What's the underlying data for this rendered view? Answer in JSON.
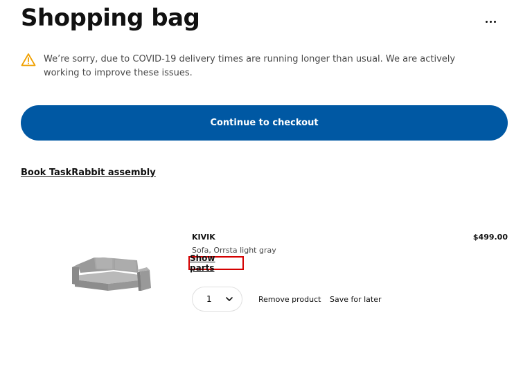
{
  "header": {
    "title": "Shopping bag",
    "more_icon": "more-horizontal-icon"
  },
  "notice": {
    "icon": "warning-triangle-icon",
    "icon_color": "#f0a000",
    "text": "We’re sorry, due to COVID-19 delivery times are running longer than usual. We are actively working to improve these issues."
  },
  "checkout": {
    "label": "Continue to checkout",
    "color": "#0058a3"
  },
  "assembly": {
    "label": "Book TaskRabbit assembly"
  },
  "cart_items": [
    {
      "name": "KIVIK",
      "description": "Sofa, Orrsta light gray",
      "price": "$499.00",
      "show_parts_label": "Show parts",
      "quantity": "1",
      "remove_label": "Remove product",
      "save_label": "Save for later",
      "image_icon": "sofa-image"
    }
  ],
  "colors": {
    "highlight_border": "#d40000",
    "text": "#111111",
    "muted_text": "#484848"
  }
}
